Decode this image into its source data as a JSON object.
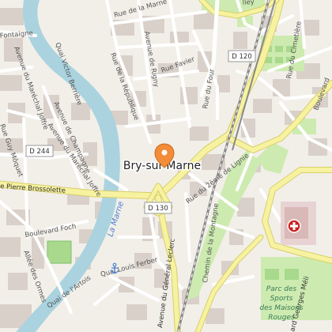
{
  "city": {
    "name": "Bry-sur-Marne"
  },
  "river": {
    "name": "La Marne"
  },
  "route_shields": [
    "D 120",
    "D 244",
    "D 130"
  ],
  "streets": {
    "rue_de_la_marne": "Rue de la Marne",
    "rue_de_la_republique": "Rue de la République",
    "avenue_de_rigny": "Avenue de Rigny",
    "rue_favier": "Rue Favier",
    "rue_du_four": "Rue du Four",
    "rue_du_cimetiere": "Rue du Cimetière",
    "boulevard_top_right": "Boulevard",
    "quai_victor_berriere": "Quai Victor Berrière",
    "avenue_de_champagne": "Avenue de Champagne",
    "avenue_du_marechal_joffre_1": "Avenue du Maréchal Joffre",
    "avenue_du_marechal_joffre_2": "Avenue du Maréchal Joffre",
    "rue_guy_mocquet": "Rue Guy Môquet",
    "rue_de_fontaigne": "Fontaigne",
    "rue_de_la_cote_de_lignie": "Rue du 2ème de Lignie",
    "rue_pierre_brossolette": "e Pierre Brossolette",
    "boulevard_foch": "Boulevard Foch",
    "allee_des_ormes": "Allée des Ormes",
    "quai_de_lartois": "Quai de l'Artois",
    "quai_louis_ferber": "Quai Louis Ferber",
    "avenue_du_general_leclerc": "Avenue du Général Leclerc",
    "chemin_de_la_montagne": "Chemin de la Montagne",
    "boulevard_georges_mendes": "ard Georges Méli",
    "rue_de_ligny_top": "lley"
  },
  "park": {
    "line1": "Parc des",
    "line2": "Sports",
    "line3": "des Maisons",
    "line4": "Rouges"
  },
  "colors": {
    "background": "#f2efe9",
    "water": "#aad3df",
    "block": "#d9d0c9",
    "major_road": "#f7f2a0",
    "railway": "#777777",
    "park": "#cdebb0",
    "marker": "#f28c38",
    "hospital": "#cc2222"
  },
  "icons": [
    "location-marker-icon",
    "hospital-icon",
    "anchor-icon"
  ]
}
